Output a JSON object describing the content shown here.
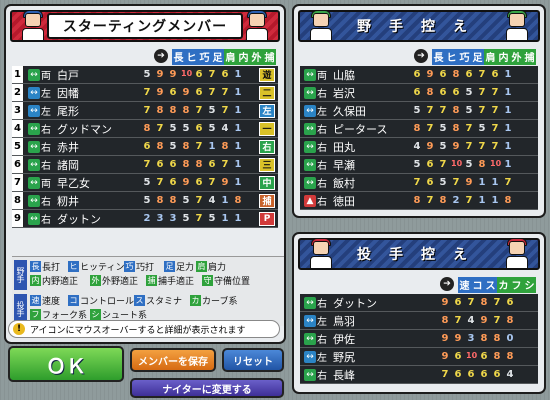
{
  "starting": {
    "title": "スターティングメンバー",
    "columns": [
      "長",
      "ヒ",
      "巧",
      "足",
      "肩",
      "内",
      "外",
      "捕"
    ],
    "col_colors": [
      "#2f6fc3",
      "#2f6fc3",
      "#2f6fc3",
      "#2f6fc3",
      "#2fa23c",
      "#2fa23c",
      "#2fa23c",
      "#2fa23c"
    ],
    "players": [
      {
        "num": "1",
        "hand": "S",
        "hand_label": "両",
        "name": "白戸",
        "stats": [
          "5",
          "9",
          "9",
          "10",
          "6",
          "7",
          "6",
          "1"
        ],
        "pos": "遊",
        "pos_color": "#d9c128"
      },
      {
        "num": "2",
        "hand": "L",
        "hand_label": "左",
        "name": "因幡",
        "stats": [
          "7",
          "9",
          "6",
          "9",
          "6",
          "7",
          "7",
          "1"
        ],
        "pos": "二",
        "pos_color": "#d9c128"
      },
      {
        "num": "3",
        "hand": "L",
        "hand_label": "左",
        "name": "尾形",
        "stats": [
          "7",
          "8",
          "8",
          "8",
          "7",
          "5",
          "7",
          "1"
        ],
        "pos": "左",
        "pos_color": "#2b84c5"
      },
      {
        "num": "4",
        "hand": "R",
        "hand_label": "右",
        "name": "グッドマン",
        "stats": [
          "8",
          "7",
          "5",
          "5",
          "6",
          "5",
          "4",
          "1"
        ],
        "pos": "一",
        "pos_color": "#d9c128"
      },
      {
        "num": "5",
        "hand": "R",
        "hand_label": "右",
        "name": "赤井",
        "stats": [
          "6",
          "8",
          "5",
          "8",
          "7",
          "1",
          "8",
          "1"
        ],
        "pos": "右",
        "pos_color": "#2aa34c"
      },
      {
        "num": "6",
        "hand": "R",
        "hand_label": "右",
        "name": "諸岡",
        "stats": [
          "7",
          "6",
          "6",
          "8",
          "8",
          "6",
          "7",
          "1"
        ],
        "pos": "三",
        "pos_color": "#d9c128"
      },
      {
        "num": "7",
        "hand": "S",
        "hand_label": "両",
        "name": "早乙女",
        "stats": [
          "5",
          "7",
          "6",
          "9",
          "6",
          "7",
          "9",
          "1"
        ],
        "pos": "中",
        "pos_color": "#2aa34c"
      },
      {
        "num": "8",
        "hand": "R",
        "hand_label": "右",
        "name": "籾井",
        "stats": [
          "5",
          "8",
          "8",
          "5",
          "7",
          "4",
          "1",
          "8"
        ],
        "pos": "捕",
        "pos_color": "#c9622a"
      },
      {
        "num": "9",
        "hand": "R",
        "hand_label": "右",
        "name": "ダットン",
        "stats": [
          "2",
          "3",
          "3",
          "5",
          "7",
          "5",
          "1",
          "1"
        ],
        "pos": "P",
        "pos_color": "#d13a3a"
      }
    ]
  },
  "bench": {
    "title": "野手控え",
    "columns": [
      "長",
      "ヒ",
      "巧",
      "足",
      "肩",
      "内",
      "外",
      "捕"
    ],
    "players": [
      {
        "hand": "S",
        "hand_label": "両",
        "name": "山脇",
        "stats": [
          "6",
          "9",
          "6",
          "8",
          "6",
          "7",
          "6",
          "1"
        ]
      },
      {
        "hand": "R",
        "hand_label": "右",
        "name": "岩沢",
        "stats": [
          "6",
          "8",
          "6",
          "6",
          "5",
          "7",
          "7",
          "1"
        ]
      },
      {
        "hand": "L",
        "hand_label": "左",
        "name": "久保田",
        "stats": [
          "5",
          "7",
          "7",
          "8",
          "5",
          "7",
          "7",
          "1"
        ]
      },
      {
        "hand": "R",
        "hand_label": "右",
        "name": "ピータース",
        "stats": [
          "8",
          "7",
          "5",
          "8",
          "7",
          "5",
          "7",
          "1"
        ]
      },
      {
        "hand": "R",
        "hand_label": "右",
        "name": "田丸",
        "stats": [
          "4",
          "9",
          "5",
          "9",
          "7",
          "7",
          "7",
          "1"
        ]
      },
      {
        "hand": "R",
        "hand_label": "右",
        "name": "早瀬",
        "stats": [
          "5",
          "6",
          "7",
          "10",
          "5",
          "8",
          "10",
          "1"
        ]
      },
      {
        "hand": "R",
        "hand_label": "右",
        "name": "飯村",
        "stats": [
          "7",
          "6",
          "5",
          "7",
          "9",
          "1",
          "1",
          "7"
        ]
      },
      {
        "hand": "R",
        "hand_label": "右",
        "name": "徳田",
        "stats": [
          "8",
          "7",
          "8",
          "2",
          "7",
          "1",
          "1",
          "8"
        ],
        "up": true
      }
    ]
  },
  "pitchers": {
    "title": "投手控え",
    "columns": [
      "速",
      "コ",
      "ス",
      "カ",
      "フ",
      "シ"
    ],
    "players": [
      {
        "hand": "R",
        "hand_label": "右",
        "name": "ダットン",
        "stats": [
          "9",
          "6",
          "7",
          "8",
          "7",
          "6"
        ]
      },
      {
        "hand": "L",
        "hand_label": "左",
        "name": "鳥羽",
        "stats": [
          "8",
          "7",
          "4",
          "9",
          "7",
          "8"
        ]
      },
      {
        "hand": "R",
        "hand_label": "右",
        "name": "伊佐",
        "stats": [
          "9",
          "9",
          "3",
          "8",
          "8",
          "0"
        ]
      },
      {
        "hand": "L",
        "hand_label": "左",
        "name": "野尻",
        "stats": [
          "9",
          "6",
          "10",
          "6",
          "8",
          "8"
        ]
      },
      {
        "hand": "R",
        "hand_label": "右",
        "name": "長峰",
        "stats": [
          "7",
          "6",
          "6",
          "6",
          "6",
          "4"
        ]
      }
    ]
  },
  "legend": {
    "fielder_tag": "野手",
    "pitcher_tag": "投手",
    "items": [
      {
        "k": "長",
        "t": "長打",
        "c": "#2f6fc3"
      },
      {
        "k": "ヒ",
        "t": "ヒッティング",
        "c": "#2f6fc3"
      },
      {
        "k": "巧",
        "t": "巧打",
        "c": "#2f6fc3"
      },
      {
        "k": "足",
        "t": "足力",
        "c": "#2f6fc3"
      },
      {
        "k": "肩",
        "t": "肩力",
        "c": "#2fa23c"
      },
      {
        "k": "内",
        "t": "内野適正",
        "c": "#2fa23c"
      },
      {
        "k": "外",
        "t": "外野適正",
        "c": "#2fa23c"
      },
      {
        "k": "捕",
        "t": "捕手適正",
        "c": "#2fa23c"
      },
      {
        "k": "守",
        "t": "守備位置",
        "c": "#2fa23c"
      },
      {
        "k": "速",
        "t": "速度",
        "c": "#2f6fc3"
      },
      {
        "k": "コ",
        "t": "コントロール",
        "c": "#2f6fc3"
      },
      {
        "k": "ス",
        "t": "スタミナ",
        "c": "#2f6fc3"
      },
      {
        "k": "カ",
        "t": "カーブ系",
        "c": "#2fa23c"
      },
      {
        "k": "フ",
        "t": "フォーク系",
        "c": "#2fa23c"
      },
      {
        "k": "シ",
        "t": "シュート系",
        "c": "#2fa23c"
      }
    ]
  },
  "info": "アイコンにマウスオーバーすると詳細が表示されます",
  "buttons": {
    "ok": "ＯＫ",
    "save": "メンバーを保存",
    "reset": "リセット",
    "night": "ナイターに変更する"
  }
}
